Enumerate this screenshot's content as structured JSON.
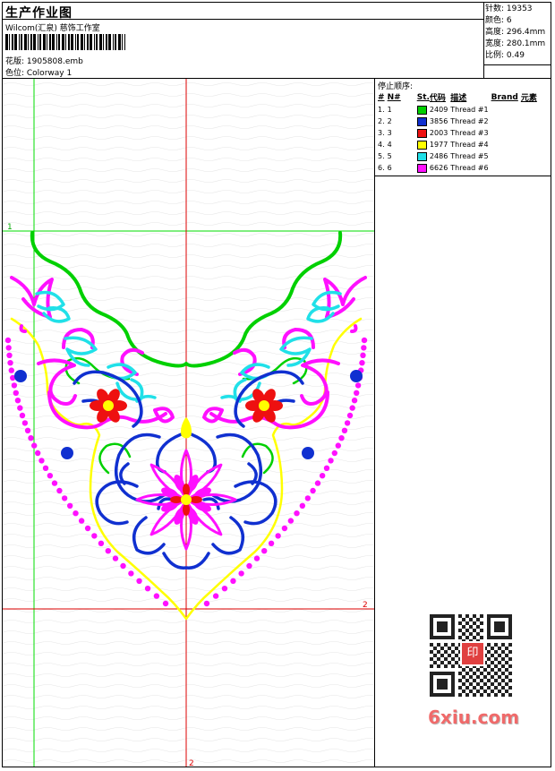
{
  "header": {
    "title": "生产作业图",
    "company": "Wilcom(汇泉) 慈饰工作室",
    "design_label": "花版: 1905808.emb",
    "colorway_label": "色位: Colorway 1"
  },
  "stats": {
    "stitches": "针数: 19353",
    "colors": "颜色: 6",
    "height": "高度: 296.4mm",
    "width": "宽度: 280.1mm",
    "ratio": "比例: 0.49"
  },
  "thread_panel": {
    "heading": "停止顺序:",
    "columns": [
      "#",
      "N#",
      "St.",
      "代码",
      "描述",
      "Brand",
      "元素"
    ],
    "rows": [
      {
        "idx": "1.",
        "n": "1",
        "code": "2409",
        "desc": "Thread #1",
        "color": "#00d000"
      },
      {
        "idx": "2.",
        "n": "2",
        "code": "3856",
        "desc": "Thread #2",
        "color": "#1030d0"
      },
      {
        "idx": "3.",
        "n": "3",
        "code": "2003",
        "desc": "Thread #3",
        "color": "#ee1010"
      },
      {
        "idx": "4.",
        "n": "4",
        "code": "1977",
        "desc": "Thread #4",
        "color": "#ffff00"
      },
      {
        "idx": "5.",
        "n": "5",
        "code": "2486",
        "desc": "Thread #5",
        "color": "#20e0e8"
      },
      {
        "idx": "6.",
        "n": "6",
        "code": "6626",
        "desc": "Thread #6",
        "color": "#ff10ff"
      }
    ]
  },
  "guides": {
    "label_1": "1",
    "label_2_right": "2",
    "label_2_bottom": "2",
    "color_green": "#00dd00",
    "color_red": "#dd0000"
  },
  "watermark": {
    "text": "6xiu.com",
    "seal": "印"
  },
  "colors": {
    "green": "#00d000",
    "blue": "#1030d0",
    "red": "#ee1010",
    "yellow": "#ffff00",
    "cyan": "#20e0e8",
    "magenta": "#ff10ff"
  }
}
